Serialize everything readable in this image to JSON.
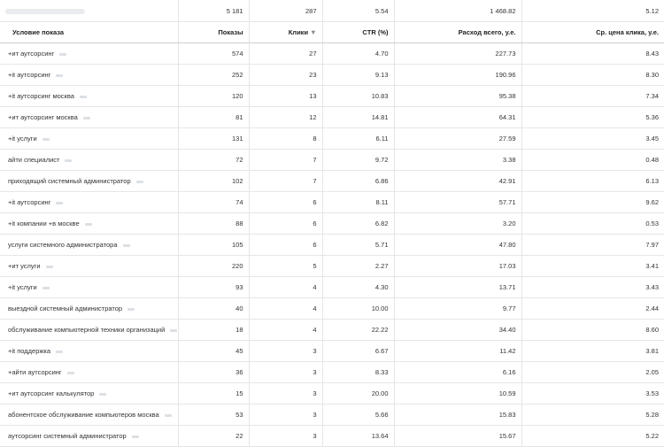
{
  "totals": {
    "impressions": "5 181",
    "clicks": "287",
    "ctr": "5.54",
    "spend": "1 468.82",
    "cpc": "5.12"
  },
  "columns": {
    "condition": "Условие показа",
    "impressions": "Показы",
    "clicks": "Клики",
    "ctr": "CTR (%)",
    "spend": "Расход всего, у.е.",
    "cpc": "Ср. цена клика, у.е."
  },
  "icons": {
    "sort": "sort-desc-icon",
    "tag": "blurred-tag-icon"
  },
  "rows": [
    {
      "condition": "+ит аутсорсинг",
      "impressions": "574",
      "clicks": "27",
      "ctr": "4.70",
      "spend": "227.73",
      "cpc": "8.43"
    },
    {
      "condition": "+it аутсорсинг",
      "impressions": "252",
      "clicks": "23",
      "ctr": "9.13",
      "spend": "190.96",
      "cpc": "8.30"
    },
    {
      "condition": "+it аутсорсинг москва",
      "impressions": "120",
      "clicks": "13",
      "ctr": "10.83",
      "spend": "95.38",
      "cpc": "7.34"
    },
    {
      "condition": "+ит аутсорсинг москва",
      "impressions": "81",
      "clicks": "12",
      "ctr": "14.81",
      "spend": "64.31",
      "cpc": "5.36"
    },
    {
      "condition": "+it услуги",
      "impressions": "131",
      "clicks": "8",
      "ctr": "6.11",
      "spend": "27.59",
      "cpc": "3.45"
    },
    {
      "condition": "айти специалист",
      "impressions": "72",
      "clicks": "7",
      "ctr": "9.72",
      "spend": "3.38",
      "cpc": "0.48"
    },
    {
      "condition": "приходящий системный администратор",
      "impressions": "102",
      "clicks": "7",
      "ctr": "6.86",
      "spend": "42.91",
      "cpc": "6.13"
    },
    {
      "condition": "+it аутсорсинг",
      "impressions": "74",
      "clicks": "6",
      "ctr": "8.11",
      "spend": "57.71",
      "cpc": "9.62"
    },
    {
      "condition": "+it компании +в москве",
      "impressions": "88",
      "clicks": "6",
      "ctr": "6.82",
      "spend": "3.20",
      "cpc": "0.53"
    },
    {
      "condition": "услуги системного администратора",
      "impressions": "105",
      "clicks": "6",
      "ctr": "5.71",
      "spend": "47.80",
      "cpc": "7.97"
    },
    {
      "condition": "+ит услуги",
      "impressions": "220",
      "clicks": "5",
      "ctr": "2.27",
      "spend": "17.03",
      "cpc": "3.41"
    },
    {
      "condition": "+it услуги",
      "impressions": "93",
      "clicks": "4",
      "ctr": "4.30",
      "spend": "13.71",
      "cpc": "3.43"
    },
    {
      "condition": "выездной системный администратор",
      "impressions": "40",
      "clicks": "4",
      "ctr": "10.00",
      "spend": "9.77",
      "cpc": "2.44"
    },
    {
      "condition": "обслуживание компьютерной техники организаций",
      "impressions": "18",
      "clicks": "4",
      "ctr": "22.22",
      "spend": "34.40",
      "cpc": "8.60"
    },
    {
      "condition": "+it поддержка",
      "impressions": "45",
      "clicks": "3",
      "ctr": "6.67",
      "spend": "11.42",
      "cpc": "3.81"
    },
    {
      "condition": "+айти аутсорсинг",
      "impressions": "36",
      "clicks": "3",
      "ctr": "8.33",
      "spend": "6.16",
      "cpc": "2.05"
    },
    {
      "condition": "+ит аутсорсинг калькулятор",
      "impressions": "15",
      "clicks": "3",
      "ctr": "20.00",
      "spend": "10.59",
      "cpc": "3.53"
    },
    {
      "condition": "абонентское обслуживание компьютеров москва",
      "impressions": "53",
      "clicks": "3",
      "ctr": "5.66",
      "spend": "15.83",
      "cpc": "5.28"
    },
    {
      "condition": "аутсорсинг системный администратор",
      "impressions": "22",
      "clicks": "3",
      "ctr": "13.64",
      "spend": "15.67",
      "cpc": "5.22"
    }
  ]
}
